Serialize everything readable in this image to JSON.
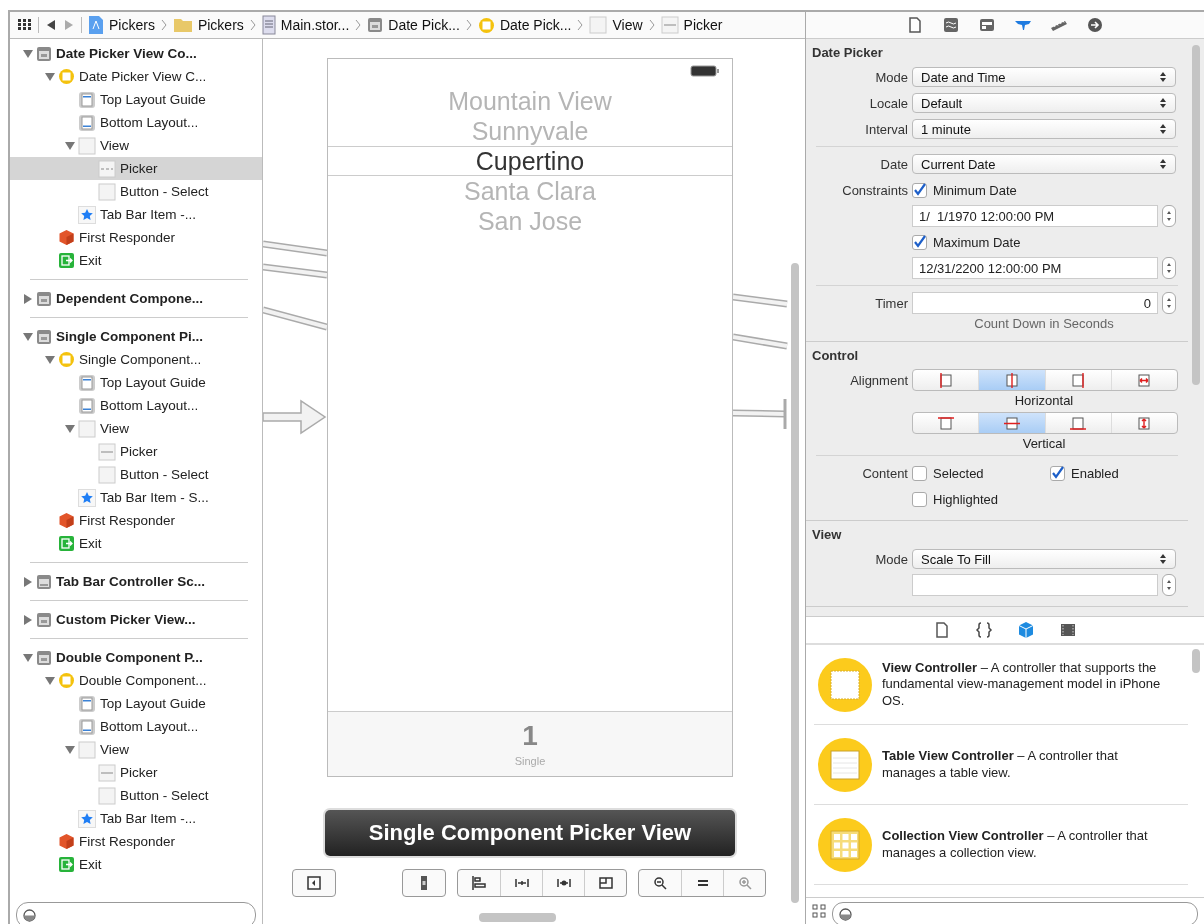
{
  "breadcrumb": [
    {
      "label": "Pickers",
      "kind": "project"
    },
    {
      "label": "Pickers",
      "kind": "folder"
    },
    {
      "label": "Main.stor...",
      "kind": "storyboard"
    },
    {
      "label": "Date Pick...",
      "kind": "scene"
    },
    {
      "label": "Date Pick...",
      "kind": "controller"
    },
    {
      "label": "View",
      "kind": "view"
    },
    {
      "label": "Picker",
      "kind": "picker"
    }
  ],
  "outline": {
    "scenes": [
      {
        "label": "Date Picker View Co...",
        "kind": "scene",
        "expanded": true,
        "selected": false,
        "children": [
          {
            "label": "Date Picker View C...",
            "kind": "controller",
            "expanded": true,
            "selected": false,
            "children": [
              {
                "label": "Top Layout Guide",
                "kind": "guide-top",
                "selected": false
              },
              {
                "label": "Bottom Layout...",
                "kind": "guide-bottom",
                "selected": false
              },
              {
                "label": "View",
                "kind": "view",
                "expanded": true,
                "selected": false,
                "children": [
                  {
                    "label": "Picker",
                    "kind": "date-picker",
                    "selected": true
                  },
                  {
                    "label": "Button - Select",
                    "kind": "button",
                    "selected": false
                  }
                ]
              },
              {
                "label": "Tab Bar Item -...",
                "kind": "tab-item",
                "selected": false
              }
            ]
          },
          {
            "label": "First Responder",
            "kind": "responder",
            "selected": false
          },
          {
            "label": "Exit",
            "kind": "exit",
            "selected": false
          }
        ]
      },
      {
        "label": "Dependent Compone...",
        "kind": "scene",
        "expanded": false,
        "selected": false
      },
      {
        "label": "Single Component Pi...",
        "kind": "scene",
        "expanded": true,
        "selected": false,
        "children": [
          {
            "label": "Single Component...",
            "kind": "controller",
            "expanded": true,
            "selected": false,
            "children": [
              {
                "label": "Top Layout Guide",
                "kind": "guide-top",
                "selected": false
              },
              {
                "label": "Bottom Layout...",
                "kind": "guide-bottom",
                "selected": false
              },
              {
                "label": "View",
                "kind": "view",
                "expanded": true,
                "selected": false,
                "children": [
                  {
                    "label": "Picker",
                    "kind": "picker",
                    "selected": false
                  },
                  {
                    "label": "Button - Select",
                    "kind": "button",
                    "selected": false
                  }
                ]
              },
              {
                "label": "Tab Bar Item - S...",
                "kind": "tab-item",
                "selected": false
              }
            ]
          },
          {
            "label": "First Responder",
            "kind": "responder",
            "selected": false
          },
          {
            "label": "Exit",
            "kind": "exit",
            "selected": false
          }
        ]
      },
      {
        "label": "Tab Bar Controller Sc...",
        "kind": "tab-scene",
        "expanded": false,
        "selected": false
      },
      {
        "label": "Custom Picker View...",
        "kind": "scene",
        "expanded": false,
        "selected": false
      },
      {
        "label": "Double Component P...",
        "kind": "scene",
        "expanded": true,
        "selected": false,
        "children": [
          {
            "label": "Double Component...",
            "kind": "controller",
            "expanded": true,
            "selected": false,
            "children": [
              {
                "label": "Top Layout Guide",
                "kind": "guide-top",
                "selected": false
              },
              {
                "label": "Bottom Layout...",
                "kind": "guide-bottom",
                "selected": false
              },
              {
                "label": "View",
                "kind": "view",
                "expanded": true,
                "selected": false,
                "children": [
                  {
                    "label": "Picker",
                    "kind": "picker",
                    "selected": false
                  },
                  {
                    "label": "Button - Select",
                    "kind": "button",
                    "selected": false
                  }
                ]
              },
              {
                "label": "Tab Bar Item -...",
                "kind": "tab-item",
                "selected": false
              }
            ]
          },
          {
            "label": "First Responder",
            "kind": "responder",
            "selected": false
          },
          {
            "label": "Exit",
            "kind": "exit",
            "selected": false
          }
        ]
      }
    ]
  },
  "canvas": {
    "picker_rows": [
      {
        "label": "Mountain View",
        "selected": false
      },
      {
        "label": "Sunnyvale",
        "selected": false
      },
      {
        "label": "Cupertino",
        "selected": true
      },
      {
        "label": "Santa Clara",
        "selected": false
      },
      {
        "label": "San Jose",
        "selected": false
      }
    ],
    "tab_bar_item": {
      "glyph": "1",
      "label": "Single"
    },
    "scene_title": "Single Component Picker View"
  },
  "inspector": {
    "tabs": [
      {
        "kind": "file",
        "selected": false
      },
      {
        "kind": "quick-help",
        "selected": false
      },
      {
        "kind": "identity",
        "selected": false
      },
      {
        "kind": "attributes",
        "selected": true
      },
      {
        "kind": "size",
        "selected": false
      },
      {
        "kind": "connections",
        "selected": false
      }
    ],
    "sections": [
      {
        "title": "Date Picker",
        "rows": [
          {
            "kind": "select",
            "label": "Mode",
            "value": "Date and Time"
          },
          {
            "kind": "select",
            "label": "Locale",
            "value": "Default"
          },
          {
            "kind": "select",
            "label": "Interval",
            "value": "1 minute"
          },
          {
            "kind": "divider"
          },
          {
            "kind": "select",
            "label": "Date",
            "value": "Current Date"
          },
          {
            "kind": "checks",
            "label": "Constraints",
            "items": [
              {
                "text": "Minimum Date",
                "checked": true
              }
            ]
          },
          {
            "kind": "stepper",
            "value": "1/  1/1970 12:00:00 PM"
          },
          {
            "kind": "checks",
            "items": [
              {
                "text": "Maximum Date",
                "checked": true
              }
            ]
          },
          {
            "kind": "stepper",
            "value": "12/31/2200 12:00:00 PM"
          },
          {
            "kind": "divider"
          },
          {
            "kind": "number",
            "label": "Timer",
            "value": "0"
          },
          {
            "kind": "note",
            "text": "Count Down in Seconds"
          }
        ]
      },
      {
        "title": "Control",
        "rows": [
          {
            "kind": "segmented",
            "label": "Alignment",
            "segments": [
              {
                "kind": "left",
                "selected": false
              },
              {
                "kind": "center-h",
                "selected": true
              },
              {
                "kind": "right",
                "selected": false
              },
              {
                "kind": "fill-h",
                "selected": false
              }
            ]
          },
          {
            "kind": "caption",
            "text": "Horizontal"
          },
          {
            "kind": "segmented",
            "segments": [
              {
                "kind": "top",
                "selected": false
              },
              {
                "kind": "center-v",
                "selected": true
              },
              {
                "kind": "bottom",
                "selected": false
              },
              {
                "kind": "fill-v",
                "selected": false
              }
            ]
          },
          {
            "kind": "caption",
            "text": "Vertical"
          },
          {
            "kind": "divider"
          },
          {
            "kind": "checks",
            "label": "Content",
            "items": [
              {
                "text": "Selected",
                "checked": false
              },
              {
                "text": "Enabled",
                "checked": true
              }
            ]
          },
          {
            "kind": "checks",
            "items": [
              {
                "text": "Highlighted",
                "checked": false
              }
            ]
          }
        ]
      },
      {
        "title": "View",
        "rows": [
          {
            "kind": "select",
            "label": "Mode",
            "value": "Scale To Fill"
          },
          {
            "kind": "stepper"
          }
        ]
      }
    ]
  },
  "library": {
    "tabs": [
      {
        "kind": "file",
        "selected": false
      },
      {
        "kind": "code",
        "selected": false
      },
      {
        "kind": "object",
        "selected": true
      },
      {
        "kind": "media",
        "selected": false
      }
    ],
    "items": [
      {
        "kind": "view-controller",
        "text": "**View Controller** – A controller that supports the fundamental view-management model in iPhone OS."
      },
      {
        "kind": "table-view-controller",
        "text": "**Table View Controller** – A controller that manages a table view."
      },
      {
        "kind": "collection-view-controller",
        "text": "**Collection View Controller** – A controller that manages a collection view."
      }
    ]
  }
}
